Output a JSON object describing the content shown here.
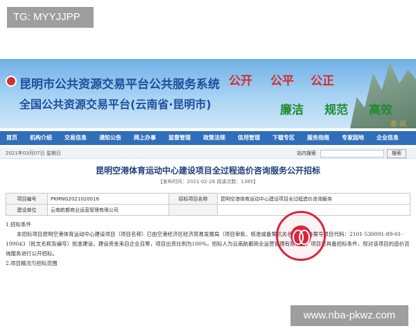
{
  "overlay": {
    "tag": "TG: MYYJJPP",
    "watermark": "www.nba-pkwz.com"
  },
  "banner": {
    "title1": "昆明市公共资源交易平台公共服务系统",
    "title2": "全国公共资源交易平台(云南省·昆明市)",
    "slogan_red": [
      "公开",
      "公平",
      "公正"
    ],
    "slogan_green": [
      "廉洁",
      "规范",
      "高效"
    ],
    "corner": "春·城"
  },
  "nav": {
    "items": [
      "首页",
      "机构介绍",
      "交易信息",
      "通知公告",
      "网上办事",
      "监督管理",
      "政策法规",
      "信用管理",
      "下载专区",
      "服务指南",
      "专家园地",
      "企业信息"
    ]
  },
  "subbar": {
    "date": "2021年03月07日  星期日",
    "search_label": "站内搜索",
    "search_value": "",
    "search_button": "搜索"
  },
  "page": {
    "title": "昆明空港体育运动中心建设项目全过程造价咨询服务公开招标",
    "meta": "【发布时间：2021-02-26  阅读次数：1385】"
  },
  "table": {
    "row1": [
      "项目编号",
      "PKMNG2021020016",
      "招标项目名称",
      "昆明空港体育运动中心建设项目全过程造价咨询服务"
    ],
    "row2": [
      "建设单位",
      "云南航都商业运营管理有限公司",
      "",
      ""
    ]
  },
  "content": {
    "heading1": "1.招标条件",
    "para": "本招标项目昆明空港体育运动中心建设项目（项目名称）已由空港经济区经济贸易发展局（项目审批、核准或备案机关名称）以备案号项目代码：2101-530091-89-01-199043（批文名称及编号）批准建设，建设资金来自企业自筹，项目出资比例为100%，招标人为云南航都商业运营管理有限公司。项目已具备招标条件，现对该项目的造价咨询服务进行公开招标。",
    "heading2": "2.项目概况与招标范围"
  }
}
